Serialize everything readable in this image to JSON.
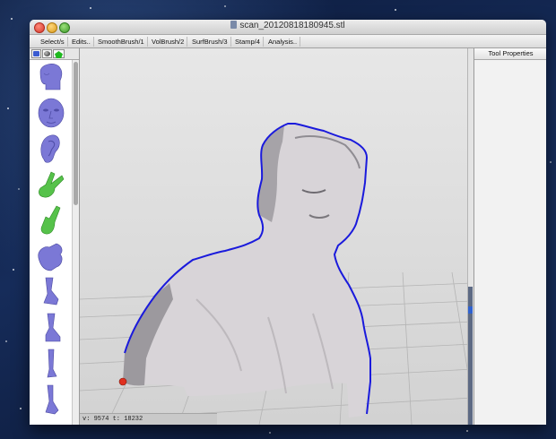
{
  "window": {
    "title": "scan_20120818180945.stl"
  },
  "menu": {
    "items": [
      "Select/s",
      "Edits..",
      "SmoothBrush/1",
      "VolBrush/2",
      "SurfBrush/3",
      "Stamp/4",
      "Analysis.."
    ]
  },
  "left_panel": {
    "tabs": [
      {
        "icon": "brush-tab-icon",
        "color": "#3a5bd0"
      },
      {
        "icon": "sphere-tab-icon",
        "color": "#2a2a2a"
      },
      {
        "icon": "pentagon-tab-icon",
        "color": "#1fb81f"
      }
    ],
    "items": [
      {
        "icon": "head-side-stamp-icon",
        "color": "#7b78d6"
      },
      {
        "icon": "face-front-stamp-icon",
        "color": "#7b78d6"
      },
      {
        "icon": "ear-stamp-icon",
        "color": "#7b78d6"
      },
      {
        "icon": "hand-peace-stamp-icon",
        "color": "#56c24a"
      },
      {
        "icon": "hand-point-stamp-icon",
        "color": "#56c24a"
      },
      {
        "icon": "fist-stamp-icon",
        "color": "#7b78d6"
      },
      {
        "icon": "leg-stamp-icon",
        "color": "#7b78d6"
      },
      {
        "icon": "foot-stamp-icon",
        "color": "#7b78d6"
      },
      {
        "icon": "lower-leg-stamp-icon",
        "color": "#7b78d6"
      },
      {
        "icon": "foot-side-stamp-icon",
        "color": "#7b78d6"
      }
    ]
  },
  "viewport": {
    "status": "v: 9574 t: 18232",
    "mesh_color": "#d8d4d8",
    "outline_color": "#1a1adc",
    "origin_marker_color": "#e03020"
  },
  "right_panel": {
    "title": "Tool Properties"
  }
}
